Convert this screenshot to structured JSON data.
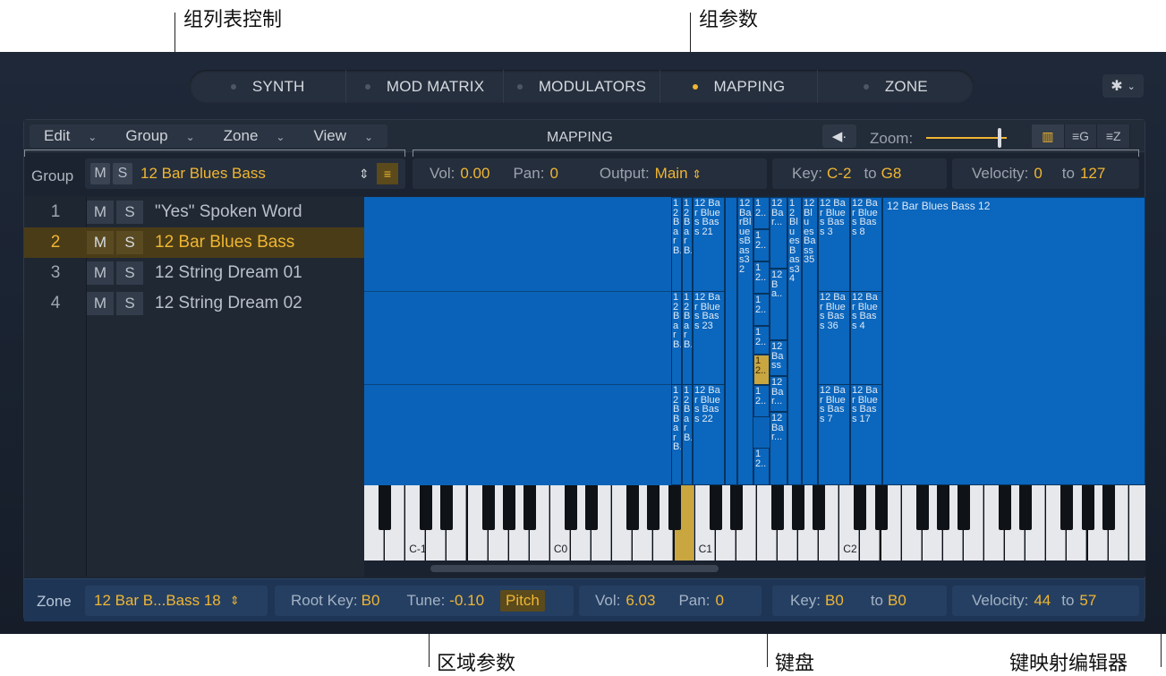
{
  "callouts": {
    "group_list_controls": "组列表控制",
    "group_params": "组参数",
    "zone_params": "区域参数",
    "keyboard": "键盘",
    "key_mapping_editor": "键映射编辑器"
  },
  "tabs": [
    {
      "label": "SYNTH",
      "active": false
    },
    {
      "label": "MOD MATRIX",
      "active": false
    },
    {
      "label": "MODULATORS",
      "active": false
    },
    {
      "label": "MAPPING",
      "active": true
    },
    {
      "label": "ZONE",
      "active": false
    }
  ],
  "toolbar": {
    "menus": [
      "Edit",
      "Group",
      "Zone",
      "View"
    ],
    "title": "MAPPING",
    "zoom_label": "Zoom:",
    "zoom_level": 0.9
  },
  "group_bar": {
    "label": "Group",
    "mute": "M",
    "solo": "S",
    "selected_group": "12 Bar Blues Bass",
    "vol_label": "Vol:",
    "vol": "0.00",
    "pan_label": "Pan:",
    "pan": "0",
    "output_label": "Output:",
    "output": "Main",
    "key_label": "Key:",
    "key_low": "C-2",
    "to_label": "to",
    "key_high": "G8",
    "velocity_label": "Velocity:",
    "vel_low": "0",
    "vel_high": "127"
  },
  "groups": [
    {
      "num": "1",
      "name": "\"Yes\" Spoken Word",
      "selected": false
    },
    {
      "num": "2",
      "name": "12 Bar Blues Bass",
      "selected": true
    },
    {
      "num": "3",
      "name": "12 String Dream 01",
      "selected": false
    },
    {
      "num": "4",
      "name": "12 String Dream 02",
      "selected": false
    }
  ],
  "editor": {
    "big_zone_label": "12 Bar Blues Bass 12",
    "zone_labels": {
      "a1": "12BarB..",
      "a2": "12BarB..",
      "a3": "12 Bar Blues Bass 21",
      "b1": "12BarB..",
      "b2": "12BarB..",
      "b3": "12 Bar Blues Bass 23",
      "c1": "12BBarB..",
      "c2": "12BarB..",
      "c3": "12 Bar Blues Bass 22",
      "d1": "12BarBluesBass32",
      "e1": "12..",
      "e2": "12..",
      "e3": "12..",
      "e4": "12..",
      "e5": "12..",
      "e6": "12..",
      "e7": "12..",
      "e8": "12..",
      "f1": "12Bar...",
      "f2": "12Ba..",
      "f3": "12Bass",
      "f4": "12Bar...",
      "f5": "12Bar...",
      "g1": "12Bar...",
      "g2": "12BluesBass34",
      "h1": "12Blu esBass35",
      "i1": "12 Bar Blue s Bass 3",
      "i2": "12 Bar Blue s Bass 36",
      "i3": "12 Bar Blue s Bass 7",
      "j1": "12 Bar Blue s Bass 8",
      "j2": "12 Bar Blue s Bass 4",
      "j3": "12 Bar Blue s Bass 17"
    }
  },
  "keyboard": {
    "labels": [
      "C-1",
      "C0",
      "C1",
      "C2"
    ]
  },
  "zone_bar": {
    "label": "Zone",
    "selected_zone": "12 Bar B...Bass 18",
    "root_key_label": "Root Key:",
    "root_key": "B0",
    "tune_label": "Tune:",
    "tune": "-0.10",
    "pitch_label": "Pitch",
    "vol_label": "Vol:",
    "vol": "6.03",
    "pan_label": "Pan:",
    "pan": "0",
    "key_label": "Key:",
    "key_low": "B0",
    "to_label": "to",
    "key_high": "B0",
    "velocity_label": "Velocity:",
    "vel_low": "44",
    "vel_high": "57"
  },
  "colors": {
    "accent": "#f0b632",
    "editor_blue": "#0b66bd",
    "panel": "#1d2532"
  }
}
